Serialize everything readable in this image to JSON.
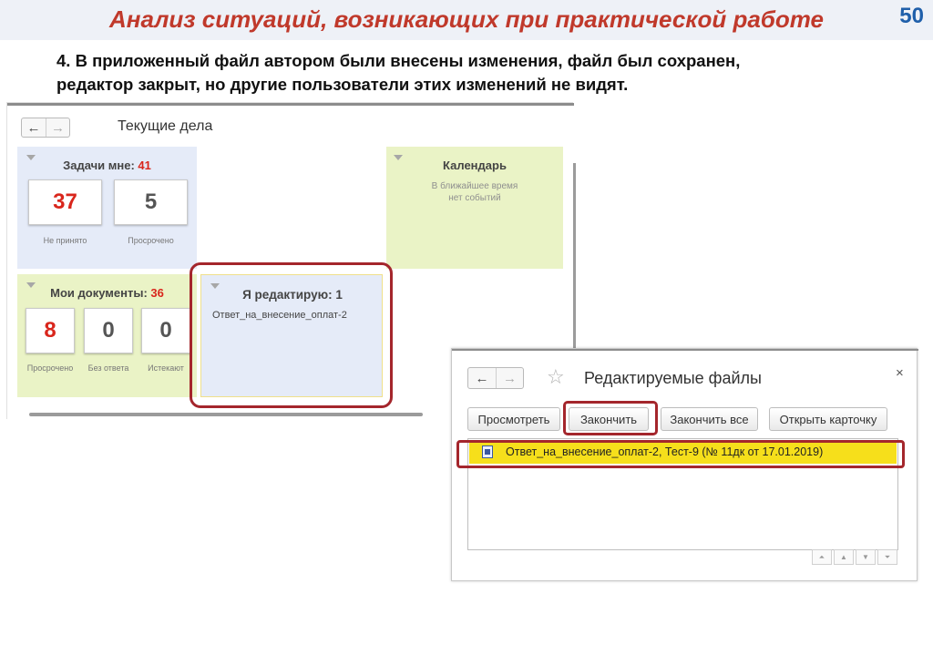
{
  "slide": {
    "title": "Анализ ситуаций, возникающих при практической работе",
    "number": "50",
    "description_line1": "4. В приложенный файл автором были внесены изменения, файл был сохранен,",
    "description_line2": "редактор закрыт, но другие пользователи этих изменений не видят."
  },
  "left_window": {
    "title": "Текущие дела",
    "nav": {
      "back": "←",
      "forward": "→"
    },
    "tasks": {
      "label": "Задачи мне: ",
      "count": "41",
      "tiles": [
        {
          "value": "37",
          "caption": "Не принято"
        },
        {
          "value": "5",
          "caption": "Просрочено"
        }
      ]
    },
    "calendar": {
      "label": "Календарь",
      "text_line1": "В ближайшее время",
      "text_line2": "нет событий"
    },
    "documents": {
      "label": "Мои документы: ",
      "count": "36",
      "tiles": [
        {
          "value": "8",
          "caption": "Просрочено"
        },
        {
          "value": "0",
          "caption": "Без ответа"
        },
        {
          "value": "0",
          "caption": "Истекают"
        }
      ]
    },
    "editing": {
      "label": "Я редактирую: 1",
      "item": "Ответ_на_внесение_оплат-2"
    }
  },
  "right_window": {
    "title": "Редактируемые файлы",
    "nav": {
      "back": "←",
      "forward": "→"
    },
    "star_icon": "☆",
    "close_icon": "×",
    "buttons": {
      "view": "Просмотреть",
      "finish": "Закончить",
      "finish_all": "Закончить все",
      "open_card": "Открыть карточку"
    },
    "rows": [
      {
        "text": "Ответ_на_внесение_оплат-2, Тест-9 (№ 11дк от 17.01.2019)"
      }
    ],
    "pager": {
      "first": "⏶",
      "up": "▲",
      "down": "▼",
      "last": "⏷"
    }
  },
  "colors": {
    "title_red": "#c0392b",
    "slide_number_blue": "#1f5faa",
    "highlight_red": "#a4262c",
    "panel_blue": "#e5ebf8",
    "panel_green": "#eaf3c6",
    "selected_row_yellow": "#f6df1b",
    "count_red": "#d9261c"
  }
}
